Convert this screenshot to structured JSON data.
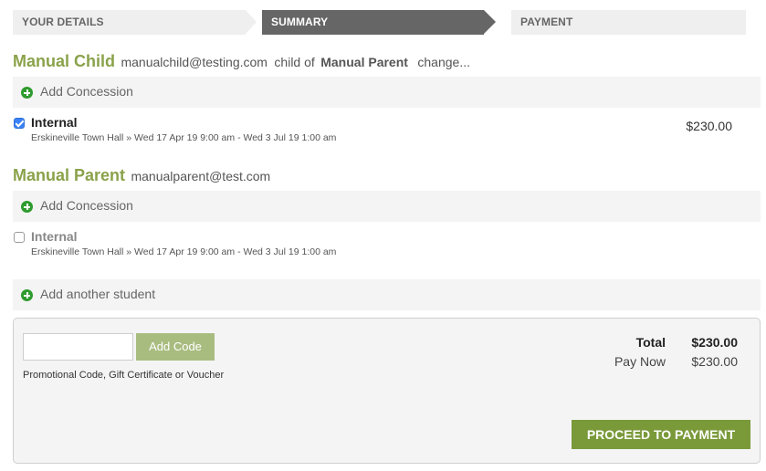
{
  "steps": {
    "step1": "YOUR DETAILS",
    "step2": "SUMMARY",
    "step3": "PAYMENT"
  },
  "students": [
    {
      "name": "Manual Child",
      "email": "manualchild@testing.com",
      "relation_text": "child of",
      "parent": "Manual Parent",
      "change_label": "change...",
      "add_concession_label": "Add Concession",
      "enrolment": {
        "checked": true,
        "title": "Internal",
        "detail": "Erskineville Town Hall » Wed 17 Apr 19 9:00 am - Wed 3 Jul 19 1:00 am",
        "price": "$230.00"
      }
    },
    {
      "name": "Manual Parent",
      "email": "manualparent@test.com",
      "add_concession_label": "Add Concession",
      "enrolment": {
        "checked": false,
        "title": "Internal",
        "detail": "Erskineville Town Hall » Wed 17 Apr 19 9:00 am - Wed 3 Jul 19 1:00 am"
      }
    }
  ],
  "add_student_label": "Add another student",
  "summary": {
    "promo_value": "",
    "add_code_label": "Add Code",
    "promo_caption": "Promotional Code, Gift Certificate or Voucher",
    "total_label": "Total",
    "total_value": "$230.00",
    "paynow_label": "Pay Now",
    "paynow_value": "$230.00",
    "proceed_label": "PROCEED TO PAYMENT"
  },
  "colors": {
    "accent_green": "#8aa24a",
    "button_green": "#7a9a3a",
    "active_step": "#666666"
  }
}
